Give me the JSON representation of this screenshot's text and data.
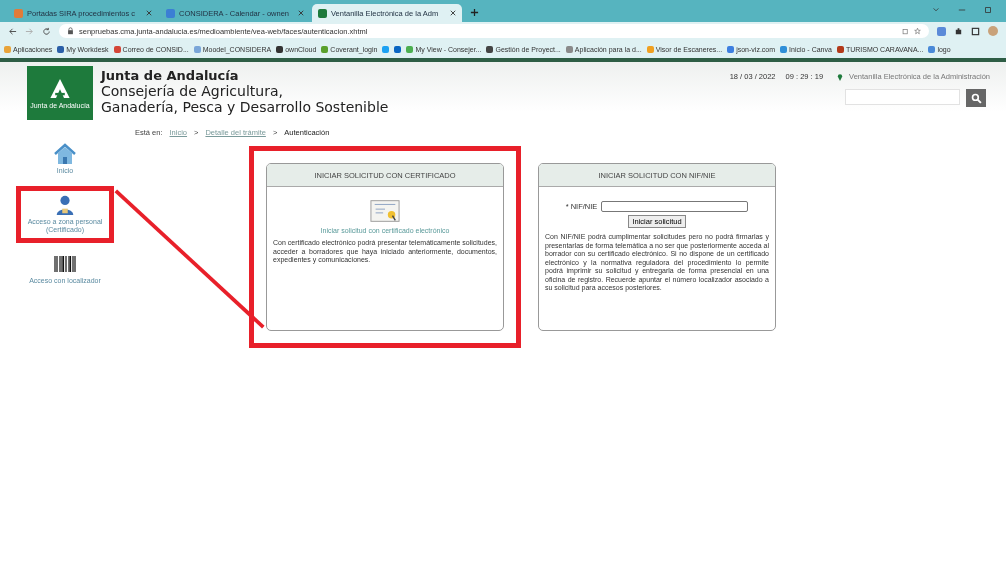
{
  "browser": {
    "tabs": [
      {
        "title": "Portadas SIRA procedimientos c",
        "selected": false,
        "color": "#e07b39"
      },
      {
        "title": "CONSIDERA - Calendar - ownen",
        "selected": false,
        "color": "#3b7fd4"
      },
      {
        "title": "Ventanilla Electrónica de la Adm",
        "selected": true,
        "color": "#1e7a3c"
      }
    ],
    "url": "senpruebas.cma.junta-andalucia.es/medioambiente/vea-web/faces/autenticacion.xhtml",
    "bookmarks": [
      {
        "label": "Aplicaciones",
        "color": "#e8a33a"
      },
      {
        "label": "My Workdesk",
        "color": "#2b5fa8"
      },
      {
        "label": "Correo de CONSID...",
        "color": "#d44638"
      },
      {
        "label": "Moodel_CONSIDERA",
        "color": "#7aa6d8"
      },
      {
        "label": "ownCloud",
        "color": "#333333"
      },
      {
        "label": "Coverant_login",
        "color": "#5aa02c"
      },
      {
        "color": "#1da1f2"
      },
      {
        "color": "#0a66c2"
      },
      {
        "label": "My View - Consejer...",
        "color": "#4caf50"
      },
      {
        "label": "Gestión de Proyect...",
        "color": "#444444"
      },
      {
        "label": "Aplicación para la d...",
        "color": "#8a8a8a"
      },
      {
        "label": "Visor de Escaneres...",
        "color": "#f0a020"
      },
      {
        "label": "json-viz.com",
        "color": "#3d7fe0"
      },
      {
        "label": "Inicio - Canva",
        "color": "#2f8fd8"
      },
      {
        "label": "TURISMO CARAVANA...",
        "color": "#b33a1a"
      },
      {
        "label": "logo",
        "color": "#4a8ad8"
      }
    ]
  },
  "header": {
    "logo_text": "Junta de Andalucía",
    "org": "Junta de Andalucía",
    "department": "Consejería de Agricultura,\nGanadería, Pesca y Desarrollo Sostenible",
    "date": "18 / 03 / 2022",
    "time": "09 : 29 : 19",
    "portal_link": "Ventanilla Electrónica de la Administración"
  },
  "breadcrumb": {
    "prefix": "Está en:",
    "items": [
      {
        "label": "Inicio",
        "current": false
      },
      {
        "label": "Detalle del trámite",
        "current": false
      },
      {
        "label": "Autenticación",
        "current": true
      }
    ],
    "separator": ">"
  },
  "sidebar": [
    {
      "kind": "home",
      "label": "Inicio",
      "highlighted": false
    },
    {
      "kind": "person",
      "label": "Acceso a zona personal (Certificado)",
      "highlighted": true
    },
    {
      "kind": "barcode",
      "label": "Acceso con localizador",
      "highlighted": false
    }
  ],
  "cards": [
    {
      "kind": "certificate",
      "title": "INICIAR SOLICITUD CON CERTIFICADO",
      "link": "Iniciar solicitud con certificado electrónico",
      "text": "Con certificado electrónico podrá presentar telemáticamente solicitudes, acceder a borradores que haya iniciado anteriormente, documentos, expedientes y comunicaciones.",
      "highlighted": true
    },
    {
      "kind": "nif",
      "title": "INICIAR SOLICITUD CON NIF/NIE",
      "field_label": "* NIF/NIE",
      "button": "Iniciar solicitud",
      "text": "Con NIF/NIE podrá cumplimentar solicitudes pero no podrá firmarlas y presentarlas de forma telemática a no ser que posteriormente acceda al borrador con su certificado electrónico. Si no dispone de un certificado electrónico y la normativa reguladora del procedimiento lo permite podrá imprimir su solicitud y entregarla de forma presencial en una oficina de registro. Recuerde apuntar el número localizador asociado a su solicitud para accesos posteriores.",
      "highlighted": false
    }
  ]
}
